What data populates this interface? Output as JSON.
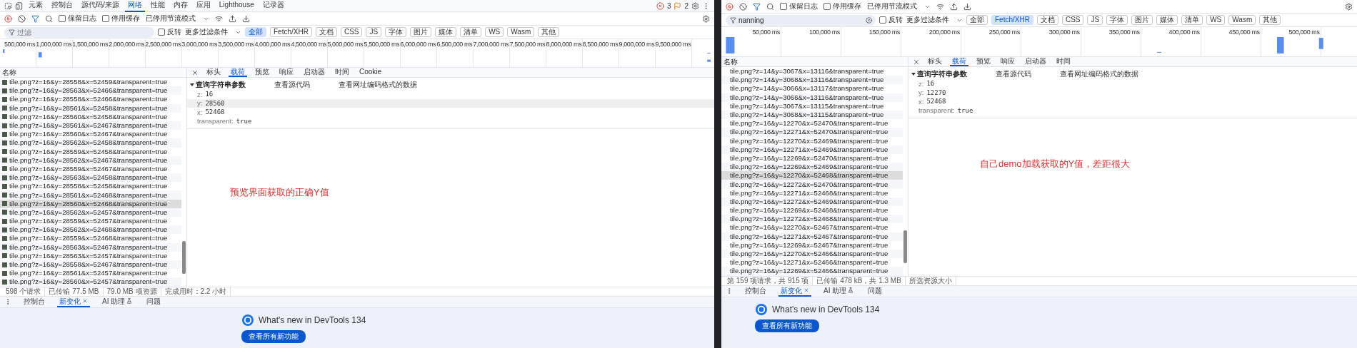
{
  "panels": [
    {
      "main_tabs": [
        {
          "label": "元素",
          "selected": false
        },
        {
          "label": "控制台",
          "selected": false
        },
        {
          "label": "源代码/来源",
          "selected": false
        },
        {
          "label": "网络",
          "selected": true
        },
        {
          "label": "性能",
          "selected": false
        },
        {
          "label": "内存",
          "selected": false
        },
        {
          "label": "应用",
          "selected": false
        },
        {
          "label": "Lighthouse",
          "selected": false
        },
        {
          "label": "记录器",
          "selected": false
        }
      ],
      "issue_counts": {
        "errors": "3",
        "warnings": "2"
      },
      "toolbar": {
        "checkboxes": [
          {
            "label": "保留日志",
            "checked": false
          },
          {
            "label": "停用缓存",
            "checked": false
          }
        ],
        "throttling": "已停用节流模式"
      },
      "filter": {
        "placeholder": "过滤"
      },
      "invert": {
        "label": "反转",
        "checked": false
      },
      "more_filters": "更多过滤条件",
      "type_filters": [
        {
          "label": "全部",
          "selected": true
        },
        {
          "label": "Fetch/XHR",
          "selected": false
        },
        {
          "label": "文档",
          "selected": false
        },
        {
          "label": "CSS",
          "selected": false
        },
        {
          "label": "JS",
          "selected": false
        },
        {
          "label": "字体",
          "selected": false
        },
        {
          "label": "图片",
          "selected": false
        },
        {
          "label": "媒体",
          "selected": false
        },
        {
          "label": "清单",
          "selected": false
        },
        {
          "label": "WS",
          "selected": false
        },
        {
          "label": "Wasm",
          "selected": false
        },
        {
          "label": "其他",
          "selected": false
        }
      ],
      "timeline_ticks": [
        "500,000 ms",
        "1,000,000 ms",
        "1,500,000 ms",
        "2,000,000 ms",
        "2,500,000 ms",
        "3,000,000 ms",
        "3,500,000 ms",
        "4,000,000 ms",
        "4,500,000 ms",
        "5,000,000 ms",
        "5,500,000 ms",
        "6,000,000 ms",
        "6,500,000 ms",
        "7,000,000 ms",
        "7,500,000 ms",
        "8,000,000 ms",
        "8,500,000 ms",
        "9,000,000 ms",
        "9,500,000 ms"
      ],
      "list": {
        "header": "名称",
        "thumbnails": true,
        "rows": [
          {
            "name": "tile.png?z=16&y=28558&x=52459&transparent=true",
            "selected": false
          },
          {
            "name": "tile.png?z=16&y=28563&x=52466&transparent=true",
            "selected": false
          },
          {
            "name": "tile.png?z=16&y=28558&x=52466&transparent=true",
            "selected": false
          },
          {
            "name": "tile.png?z=16&y=28561&x=52458&transparent=true",
            "selected": false
          },
          {
            "name": "tile.png?z=16&y=28560&x=52458&transparent=true",
            "selected": false
          },
          {
            "name": "tile.png?z=16&y=28561&x=52467&transparent=true",
            "selected": false
          },
          {
            "name": "tile.png?z=16&y=28560&x=52467&transparent=true",
            "selected": false
          },
          {
            "name": "tile.png?z=16&y=28562&x=52458&transparent=true",
            "selected": false
          },
          {
            "name": "tile.png?z=16&y=28559&x=52458&transparent=true",
            "selected": false
          },
          {
            "name": "tile.png?z=16&y=28562&x=52467&transparent=true",
            "selected": false
          },
          {
            "name": "tile.png?z=16&y=28559&x=52467&transparent=true",
            "selected": false
          },
          {
            "name": "tile.png?z=16&y=28563&x=52458&transparent=true",
            "selected": false
          },
          {
            "name": "tile.png?z=16&y=28558&x=52458&transparent=true",
            "selected": false
          },
          {
            "name": "tile.png?z=16&y=28561&x=52468&transparent=true",
            "selected": false
          },
          {
            "name": "tile.png?z=16&y=28560&x=52468&transparent=true",
            "selected": true
          },
          {
            "name": "tile.png?z=16&y=28562&x=52457&transparent=true",
            "selected": false
          },
          {
            "name": "tile.png?z=16&y=28559&x=52457&transparent=true",
            "selected": false
          },
          {
            "name": "tile.png?z=16&y=28562&x=52468&transparent=true",
            "selected": false
          },
          {
            "name": "tile.png?z=16&y=28559&x=52468&transparent=true",
            "selected": false
          },
          {
            "name": "tile.png?z=16&y=28563&x=52467&transparent=true",
            "selected": false
          },
          {
            "name": "tile.png?z=16&y=28563&x=52457&transparent=true",
            "selected": false
          },
          {
            "name": "tile.png?z=16&y=28558&x=52467&transparent=true",
            "selected": false
          },
          {
            "name": "tile.png?z=16&y=28561&x=52457&transparent=true",
            "selected": false
          },
          {
            "name": "tile.png?z=16&y=28560&x=52457&transparent=true",
            "selected": false
          }
        ]
      },
      "detail_tabs": [
        {
          "label": "标头",
          "selected": false
        },
        {
          "label": "载荷",
          "selected": true
        },
        {
          "label": "预览",
          "selected": false
        },
        {
          "label": "响应",
          "selected": false
        },
        {
          "label": "启动器",
          "selected": false
        },
        {
          "label": "时间",
          "selected": false
        },
        {
          "label": "Cookie",
          "selected": false
        }
      ],
      "payload": {
        "section": "查询字符串参数",
        "expanded": true,
        "links": [
          "查看源代码",
          "查看网址编码格式的数据"
        ],
        "params": [
          {
            "key": "z:",
            "value": "16",
            "selected": false
          },
          {
            "key": "y:",
            "value": "28560",
            "selected": true
          },
          {
            "key": "x:",
            "value": "52468",
            "selected": false
          },
          {
            "key": "transparent:",
            "value": "true",
            "selected": false
          }
        ]
      },
      "annotation": "预览界面获取的正确Y值",
      "status": [
        "598 个请求",
        "已传输 77.5 MB",
        "79.0 MB 项资源",
        "完成用时：2.2 小时"
      ],
      "drawer": {
        "tabs": [
          {
            "label": "控制台",
            "selected": false,
            "closable": false
          },
          {
            "label": "新变化",
            "selected": true,
            "closable": true
          },
          {
            "label": "AI 助理",
            "selected": false,
            "closable": false,
            "experimental": true
          },
          {
            "label": "问题",
            "selected": false,
            "closable": false
          }
        ],
        "title": "What's new in DevTools 134",
        "button": "查看所有新功能"
      }
    },
    {
      "toolbar": {
        "checkboxes": [
          {
            "label": "保留日志",
            "checked": false
          },
          {
            "label": "停用缓存",
            "checked": false
          }
        ],
        "throttling": "已停用节流模式"
      },
      "filter": {
        "value": "nanning"
      },
      "invert": {
        "label": "反转",
        "checked": false
      },
      "more_filters": "更多过滤条件",
      "type_filters": [
        {
          "label": "全部",
          "selected": false
        },
        {
          "label": "Fetch/XHR",
          "selected": true
        },
        {
          "label": "文档",
          "selected": false
        },
        {
          "label": "CSS",
          "selected": false
        },
        {
          "label": "JS",
          "selected": false
        },
        {
          "label": "字体",
          "selected": false
        },
        {
          "label": "图片",
          "selected": false
        },
        {
          "label": "媒体",
          "selected": false
        },
        {
          "label": "清单",
          "selected": false
        },
        {
          "label": "WS",
          "selected": false
        },
        {
          "label": "Wasm",
          "selected": false
        },
        {
          "label": "其他",
          "selected": false
        }
      ],
      "timeline_ticks": [
        "50,000 ms",
        "100,000 ms",
        "150,000 ms",
        "200,000 ms",
        "250,000 ms",
        "300,000 ms",
        "350,000 ms",
        "400,000 ms",
        "450,000 ms",
        "500,000 ms"
      ],
      "list": {
        "header": "名称",
        "thumbnails": false,
        "rows": [
          {
            "name": "tile.png?z=14&y=3067&x=13116&transparent=true",
            "selected": false
          },
          {
            "name": "tile.png?z=14&y=3068&x=13116&transparent=true",
            "selected": false
          },
          {
            "name": "tile.png?z=14&y=3066&x=13117&transparent=true",
            "selected": false
          },
          {
            "name": "tile.png?z=14&y=3066&x=13116&transparent=true",
            "selected": false
          },
          {
            "name": "tile.png?z=14&y=3067&x=13115&transparent=true",
            "selected": false
          },
          {
            "name": "tile.png?z=14&y=3068&x=13115&transparent=true",
            "selected": false
          },
          {
            "name": "tile.png?z=16&y=12270&x=52470&transparent=true",
            "selected": false
          },
          {
            "name": "tile.png?z=16&y=12271&x=52470&transparent=true",
            "selected": false
          },
          {
            "name": "tile.png?z=16&y=12270&x=52469&transparent=true",
            "selected": false
          },
          {
            "name": "tile.png?z=16&y=12271&x=52469&transparent=true",
            "selected": false
          },
          {
            "name": "tile.png?z=16&y=12269&x=52470&transparent=true",
            "selected": false
          },
          {
            "name": "tile.png?z=16&y=12269&x=52469&transparent=true",
            "selected": false
          },
          {
            "name": "tile.png?z=16&y=12270&x=52468&transparent=true",
            "selected": true
          },
          {
            "name": "tile.png?z=16&y=12272&x=52470&transparent=true",
            "selected": false
          },
          {
            "name": "tile.png?z=16&y=12271&x=52468&transparent=true",
            "selected": false
          },
          {
            "name": "tile.png?z=16&y=12272&x=52469&transparent=true",
            "selected": false
          },
          {
            "name": "tile.png?z=16&y=12269&x=52468&transparent=true",
            "selected": false
          },
          {
            "name": "tile.png?z=16&y=12272&x=52468&transparent=true",
            "selected": false
          },
          {
            "name": "tile.png?z=16&y=12270&x=52467&transparent=true",
            "selected": false
          },
          {
            "name": "tile.png?z=16&y=12271&x=52467&transparent=true",
            "selected": false
          },
          {
            "name": "tile.png?z=16&y=12269&x=52467&transparent=true",
            "selected": false
          },
          {
            "name": "tile.png?z=16&y=12270&x=52466&transparent=true",
            "selected": false
          },
          {
            "name": "tile.png?z=16&y=12271&x=52466&transparent=true",
            "selected": false
          },
          {
            "name": "tile.png?z=16&y=12269&x=52466&transparent=true",
            "selected": false
          }
        ]
      },
      "detail_tabs": [
        {
          "label": "标头",
          "selected": false
        },
        {
          "label": "载荷",
          "selected": true
        },
        {
          "label": "预览",
          "selected": false
        },
        {
          "label": "响应",
          "selected": false
        },
        {
          "label": "启动器",
          "selected": false
        },
        {
          "label": "时间",
          "selected": false
        }
      ],
      "payload": {
        "section": "查询字符串参数",
        "expanded": true,
        "links": [
          "查看源代码",
          "查看网址编码格式的数据"
        ],
        "params": [
          {
            "key": "z:",
            "value": "16",
            "selected": false
          },
          {
            "key": "y:",
            "value": "12270",
            "selected": false
          },
          {
            "key": "x:",
            "value": "52468",
            "selected": false
          },
          {
            "key": "transparent:",
            "value": "true",
            "selected": false
          }
        ]
      },
      "annotation": "自己demo加载获取的Y值，差距很大",
      "status": [
        "第 159 项请求，共 915 项",
        "已传输 478 kB，共 1.3 MB",
        "所选资源大小"
      ],
      "drawer": {
        "tabs": [
          {
            "label": "控制台",
            "selected": false,
            "closable": false
          },
          {
            "label": "新变化",
            "selected": true,
            "closable": true
          },
          {
            "label": "AI 助理",
            "selected": false,
            "closable": false,
            "experimental": true
          },
          {
            "label": "问题",
            "selected": false,
            "closable": false
          }
        ],
        "title": "What's new in DevTools 134",
        "button": "查看所有新功能"
      }
    }
  ]
}
